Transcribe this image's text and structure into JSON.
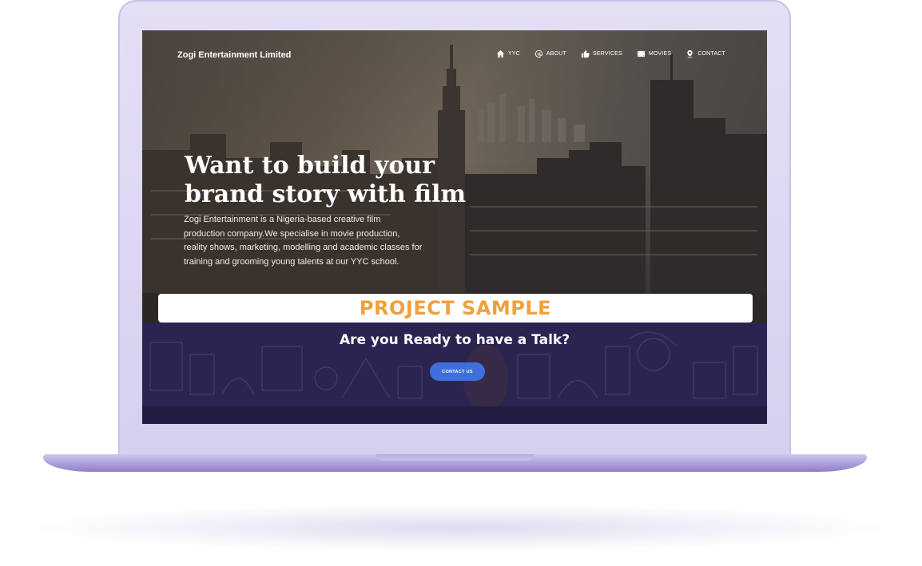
{
  "site": {
    "brand": "Zogi Entertainment Limited",
    "nav": [
      {
        "label": "YYC",
        "icon": "home-icon"
      },
      {
        "label": "ABOUT",
        "icon": "at-icon"
      },
      {
        "label": "SERVICES",
        "icon": "thumbs-up-icon"
      },
      {
        "label": "MOVIES",
        "icon": "film-icon"
      },
      {
        "label": "CONTACT",
        "icon": "map-pin-icon"
      }
    ]
  },
  "hero": {
    "headline_line1": "Want to build your",
    "headline_line2": "brand story with film",
    "description": "Zogi Entertainment is a Nigeria-based creative film production company.We specialise in movie production, reality shows, marketing, modelling and academic classes for training and grooming young talents at our YYC school."
  },
  "overlay": {
    "label": "PROJECT SAMPLE",
    "color": "#f0a03c"
  },
  "cta": {
    "title": "Are you Ready to have a Talk?",
    "button_label": "CONTACT US",
    "button_color": "#3f6fdb"
  },
  "colors": {
    "device": "#d6cfee",
    "cta_background": "#2b2450"
  }
}
